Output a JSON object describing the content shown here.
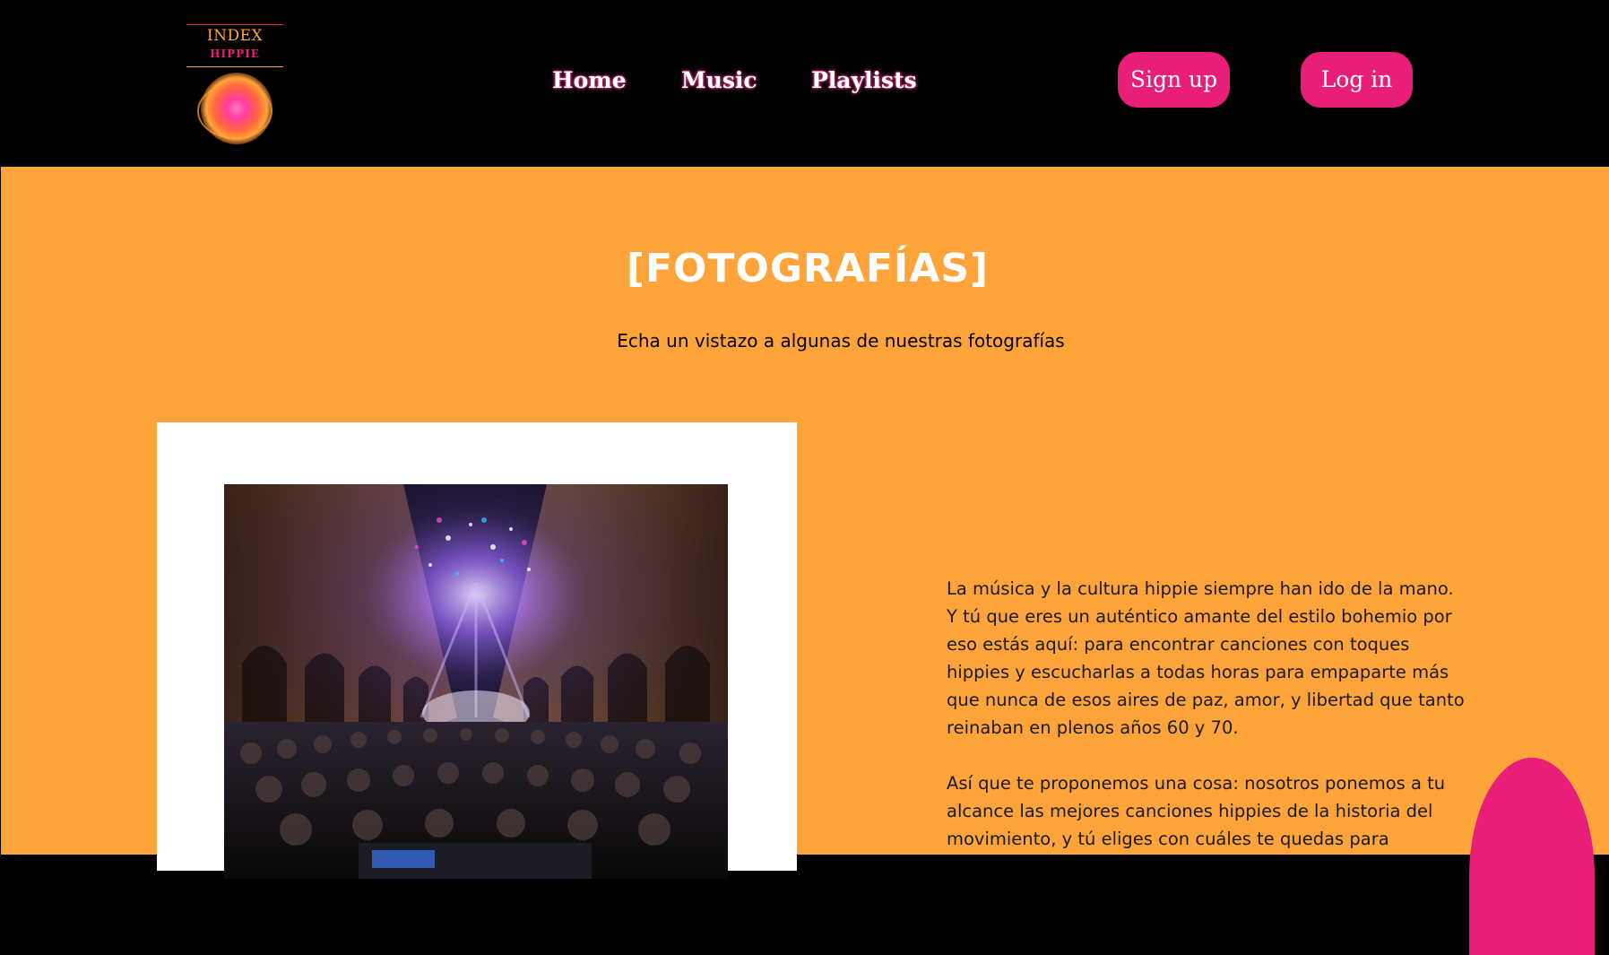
{
  "header": {
    "logo": {
      "line1": "INDEX",
      "line2": "HIPPIE"
    },
    "nav": [
      {
        "label": "Home"
      },
      {
        "label": "Music"
      },
      {
        "label": "Playlists"
      }
    ],
    "signup_label": "Sign up",
    "login_label": "Log  in"
  },
  "main": {
    "title": "[FOTOGRAFÍAS]",
    "subtitle": "Echa un vistazo a algunas de nuestras fotografías",
    "paragraphs": [
      "La música y la cultura hippie siempre han ido de la mano. Y tú que eres un auténtico amante del estilo bohemio por eso estás aquí: para encontrar canciones con toques hippies y escucharlas a todas horas para empaparte más que nunca de esos aires de paz, amor, y libertad que tanto reinaban en plenos años 60 y 70.",
      "Así que te proponemos una cosa: nosotros ponemos a tu alcance las mejores canciones hippies de la historia del movimiento, y tú eliges con cuáles te quedas para"
    ]
  },
  "colors": {
    "orange": "#ffa43a",
    "pink": "#e91e78",
    "black": "#000000",
    "white": "#ffffff"
  }
}
